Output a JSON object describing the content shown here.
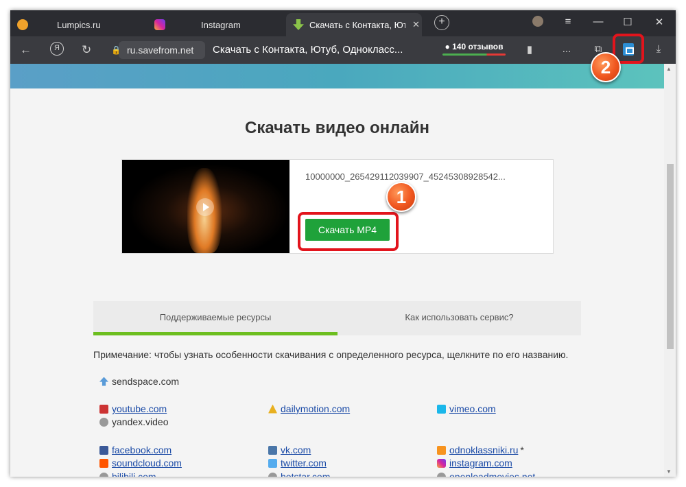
{
  "browser": {
    "tabs": [
      {
        "label": "Lumpics.ru",
        "icon": "lumpics-favicon",
        "color": "#f0a22b"
      },
      {
        "label": "Instagram",
        "icon": "instagram-favicon",
        "color": "#d6249f"
      },
      {
        "label": "Скачать с Контакта, Ют",
        "icon": "savefrom-favicon",
        "color": "#8bc34a",
        "close": "✕"
      }
    ],
    "new_tab": "+",
    "url": "ru.savefrom.net",
    "page_title": "Скачать с Контакта, Ютуб, Однокласс...",
    "reviews": "140 отзывов",
    "more_label": "...",
    "window_controls": {
      "minimize": "—",
      "maximize": "☐",
      "close": "✕",
      "menu": "≡"
    }
  },
  "annotations": {
    "badge1": "1",
    "badge2": "2"
  },
  "page": {
    "heading": "Скачать видео онлайн",
    "result": {
      "filename": "10000000_265429112039907_45245308928542...",
      "download_label": "Скачать   MP4"
    },
    "tabs": [
      "Поддерживаемые ресурсы",
      "Как использовать сервис?"
    ],
    "note": "Примечание: чтобы узнать особенности скачивания с определенного ресурса, щелкните по его названию.",
    "resources": {
      "sendspace": "sendspace.com",
      "youtube": "youtube.com",
      "yandex": "yandex.video",
      "dailymotion": "dailymotion.com",
      "vimeo": "vimeo.com",
      "facebook": "facebook.com",
      "soundcloud": "soundcloud.com",
      "bilibili": "bilibili.com",
      "vk": "vk.com",
      "twitter": "twitter.com",
      "hotstar": "hotstar.com",
      "odnoklassniki": "odnoklassniki.ru",
      "odnoklassniki_mark": "*",
      "instagram": "instagram.com",
      "openload": "openloadmovies.net"
    }
  },
  "colors": {
    "accent_green": "#1fa23a",
    "highlight_red": "#e2141c",
    "link_blue": "#1a4aa6"
  }
}
